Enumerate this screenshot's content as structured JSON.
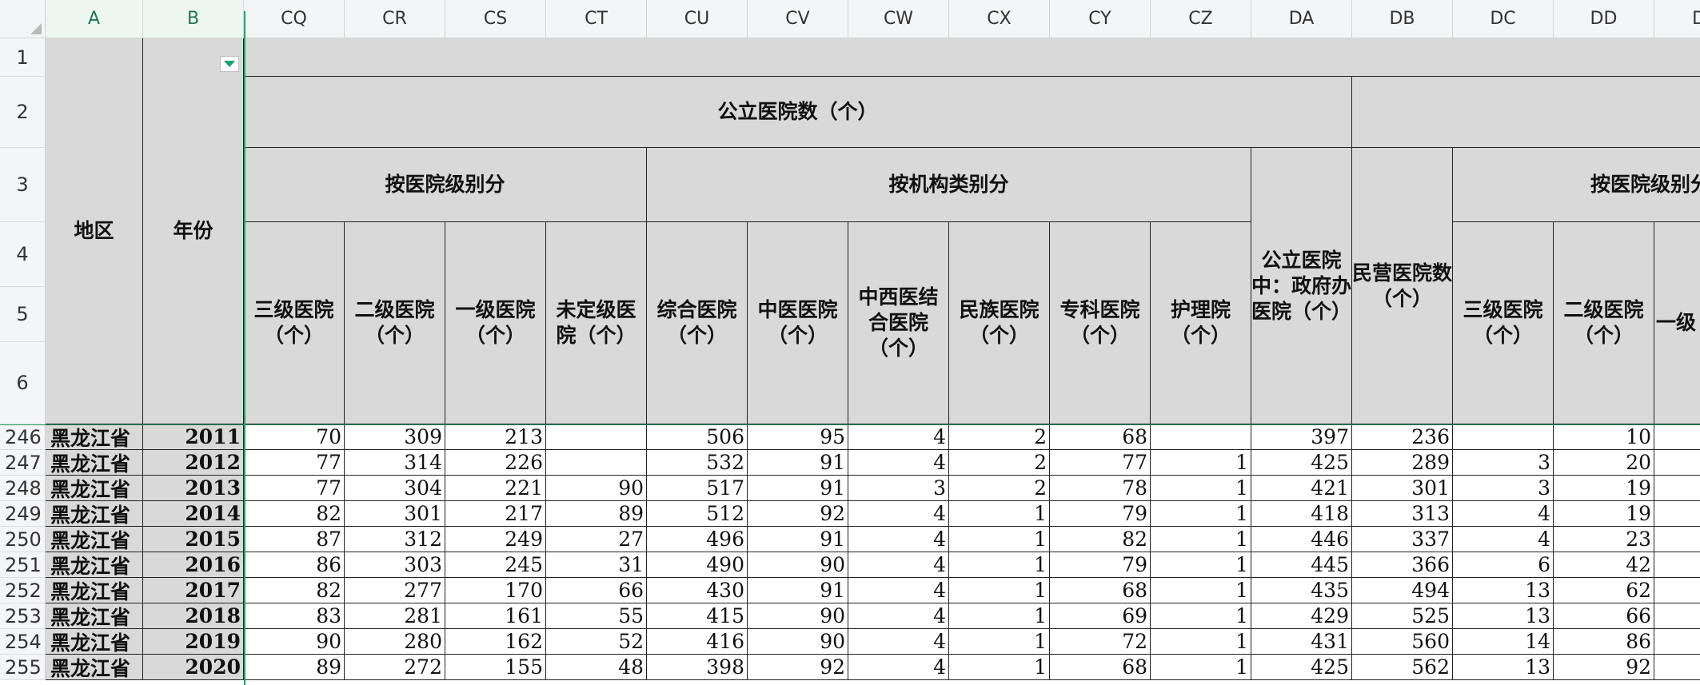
{
  "columns": [
    "",
    "A",
    "B",
    "CQ",
    "CR",
    "CS",
    "CT",
    "CU",
    "CV",
    "CW",
    "CX",
    "CY",
    "CZ",
    "DA",
    "DB",
    "DC",
    "DD",
    "DE"
  ],
  "active_columns": [
    "A",
    "B"
  ],
  "header_rows": [
    "1",
    "2",
    "3",
    "4",
    "5",
    "6"
  ],
  "headers": {
    "region": "地区",
    "year": "年份",
    "public_hospitals": "公立医院数（个）",
    "by_level": "按医院级别分",
    "by_type": "按机构类别分",
    "by_level_right": "按医院级别分",
    "tertiary": "三级医院（个）",
    "secondary": "二级医院（个）",
    "primary": "一级医院（个）",
    "unrated": "未定级医院（个）",
    "general": "综合医院（个）",
    "tcm": "中医医院（个）",
    "integrated": "中西医结合医院（个）",
    "ethnic": "民族医院（个）",
    "specialized": "专科医院（个）",
    "nursing": "护理院（个）",
    "gov_run": "公立医院中：政府办医院（个）",
    "private": "民营医院数（个）",
    "tertiary_r": "三级医院（个）",
    "secondary_r": "二级医院（个）",
    "primary_r": "一级（个）"
  },
  "rows": [
    {
      "num": "246",
      "region": "黑龙江省",
      "year": "2011",
      "values": [
        "70",
        "309",
        "213",
        "",
        "506",
        "95",
        "4",
        "2",
        "68",
        "",
        "397",
        "236",
        "",
        "10"
      ]
    },
    {
      "num": "247",
      "region": "黑龙江省",
      "year": "2012",
      "values": [
        "77",
        "314",
        "226",
        "",
        "532",
        "91",
        "4",
        "2",
        "77",
        "1",
        "425",
        "289",
        "3",
        "20"
      ]
    },
    {
      "num": "248",
      "region": "黑龙江省",
      "year": "2013",
      "values": [
        "77",
        "304",
        "221",
        "90",
        "517",
        "91",
        "3",
        "2",
        "78",
        "1",
        "421",
        "301",
        "3",
        "19"
      ]
    },
    {
      "num": "249",
      "region": "黑龙江省",
      "year": "2014",
      "values": [
        "82",
        "301",
        "217",
        "89",
        "512",
        "92",
        "4",
        "1",
        "79",
        "1",
        "418",
        "313",
        "4",
        "19"
      ]
    },
    {
      "num": "250",
      "region": "黑龙江省",
      "year": "2015",
      "values": [
        "87",
        "312",
        "249",
        "27",
        "496",
        "91",
        "4",
        "1",
        "82",
        "1",
        "446",
        "337",
        "4",
        "23"
      ]
    },
    {
      "num": "251",
      "region": "黑龙江省",
      "year": "2016",
      "values": [
        "86",
        "303",
        "245",
        "31",
        "490",
        "90",
        "4",
        "1",
        "79",
        "1",
        "445",
        "366",
        "6",
        "42"
      ]
    },
    {
      "num": "252",
      "region": "黑龙江省",
      "year": "2017",
      "values": [
        "82",
        "277",
        "170",
        "66",
        "430",
        "91",
        "4",
        "1",
        "68",
        "1",
        "435",
        "494",
        "13",
        "62"
      ]
    },
    {
      "num": "253",
      "region": "黑龙江省",
      "year": "2018",
      "values": [
        "83",
        "281",
        "161",
        "55",
        "415",
        "90",
        "4",
        "1",
        "69",
        "1",
        "429",
        "525",
        "13",
        "66"
      ]
    },
    {
      "num": "254",
      "region": "黑龙江省",
      "year": "2019",
      "values": [
        "90",
        "280",
        "162",
        "52",
        "416",
        "90",
        "4",
        "1",
        "72",
        "1",
        "431",
        "560",
        "14",
        "86"
      ]
    },
    {
      "num": "255",
      "region": "黑龙江省",
      "year": "2020",
      "values": [
        "89",
        "272",
        "155",
        "48",
        "398",
        "92",
        "4",
        "1",
        "68",
        "1",
        "425",
        "562",
        "13",
        "92"
      ]
    }
  ]
}
